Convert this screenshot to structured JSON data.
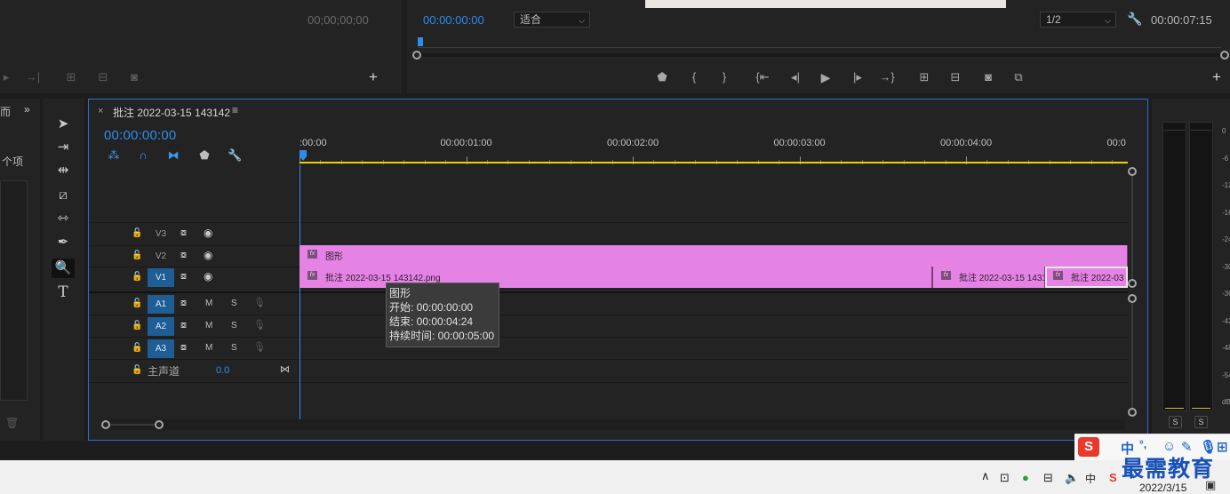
{
  "source_monitor": {
    "timecode": "00;00;00;00"
  },
  "program_monitor": {
    "timecode": "00:00:00:00",
    "fit_select": "适合",
    "resolution_select": "1/2",
    "duration": "00:00:07:15"
  },
  "left_strip": {
    "partial_text_1": "而",
    "partial_text_2": "个项"
  },
  "timeline": {
    "tab_close": "×",
    "sequence_title": "批注 2022-03-15 143142",
    "menu_icon": "≡",
    "playhead_timecode": "00:00:00:00",
    "ruler_labels": [
      ":00:00",
      "00:00:01:00",
      "00:00:02:00",
      "00:00:03:00",
      "00:00:04:00",
      "00:0"
    ],
    "tracks": {
      "v3": {
        "name": "V3"
      },
      "v2": {
        "name": "V2"
      },
      "v1": {
        "name": "V1"
      },
      "a1": {
        "name": "A1",
        "mute": "M",
        "solo": "S"
      },
      "a2": {
        "name": "A2",
        "mute": "M",
        "solo": "S"
      },
      "a3": {
        "name": "A3",
        "mute": "M",
        "solo": "S"
      },
      "master": {
        "name": "主声道",
        "value": "0.0"
      }
    },
    "clips": {
      "graphic": {
        "label": "图形",
        "fx": "fx"
      },
      "png1": {
        "label": "批注 2022-03-15  143142.png",
        "fx": "fx"
      },
      "png2": {
        "label": "批注 2022-03-15 1431",
        "fx": "fx"
      },
      "png3": {
        "label": "批注 2022-03",
        "fx": "fx"
      }
    },
    "tooltip": {
      "title": "图形",
      "start": "开始: 00:00:00:00",
      "end": "结束: 00:00:04:24",
      "duration": "持续时间: 00:00:05:00"
    }
  },
  "audio_meter": {
    "db_labels": [
      "0",
      "-6",
      "-12",
      "-18",
      "-24",
      "-30",
      "-36",
      "-42",
      "-48",
      "-54",
      "dB"
    ],
    "solo_left": "S",
    "solo_right": "S"
  },
  "ime": {
    "chinese": "中",
    "punct": "°,"
  },
  "taskbar": {
    "ime_mode": "中",
    "date": "2022/3/15"
  },
  "watermark": "最需教育",
  "colors": {
    "accent": "#2d8ceb",
    "clip": "#e483e4",
    "track_on": "#1f5d95",
    "work_area": "#e8d400"
  }
}
